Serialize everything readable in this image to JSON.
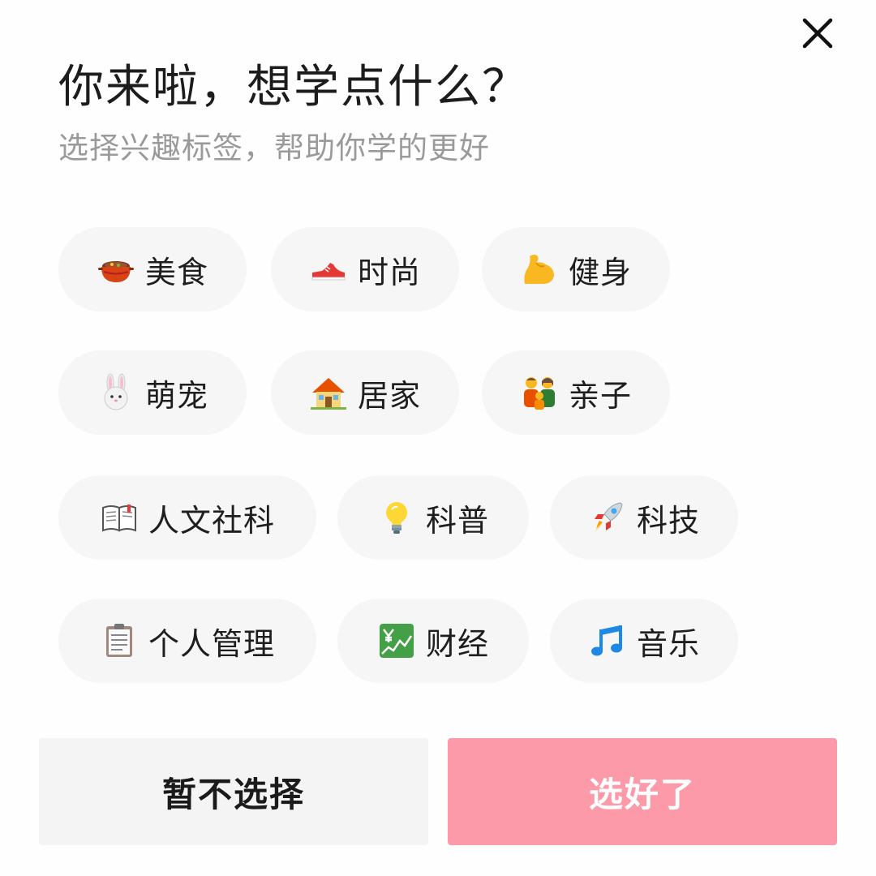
{
  "dialog": {
    "title": "你来啦，想学点什么？",
    "subtitle": "选择兴趣标签，帮助你学的更好",
    "close_icon": "close-icon"
  },
  "tags": [
    {
      "label": "美食",
      "icon": "food-pot-icon"
    },
    {
      "label": "时尚",
      "icon": "sneaker-icon"
    },
    {
      "label": "健身",
      "icon": "flexed-biceps-icon"
    },
    {
      "label": "萌宠",
      "icon": "rabbit-face-icon"
    },
    {
      "label": "居家",
      "icon": "house-icon"
    },
    {
      "label": "亲子",
      "icon": "family-icon"
    },
    {
      "label": "人文社科",
      "icon": "open-book-icon"
    },
    {
      "label": "科普",
      "icon": "light-bulb-icon"
    },
    {
      "label": "科技",
      "icon": "rocket-icon"
    },
    {
      "label": "个人管理",
      "icon": "clipboard-icon"
    },
    {
      "label": "财经",
      "icon": "yen-chart-icon"
    },
    {
      "label": "音乐",
      "icon": "music-notes-icon"
    }
  ],
  "buttons": {
    "skip_label": "暂不选择",
    "confirm_label": "选好了"
  },
  "colors": {
    "tag_background": "#f6f6f6",
    "confirm_button": "#fc9aa9",
    "skip_button": "#f4f4f4",
    "subtitle_text": "#9a9a9a"
  }
}
